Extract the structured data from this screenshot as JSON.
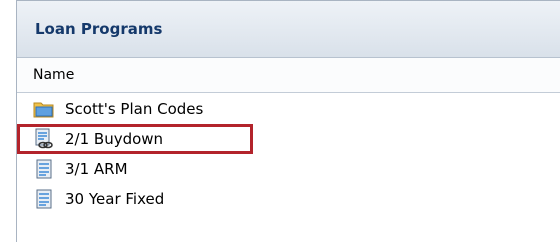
{
  "panel": {
    "title": "Loan Programs",
    "column_header": "Name"
  },
  "items": [
    {
      "label": "Scott's Plan Codes",
      "icon": "folder-icon"
    },
    {
      "label": "2/1 Buydown",
      "icon": "linked-document-icon",
      "highlighted": true
    },
    {
      "label": "3/1 ARM",
      "icon": "document-icon"
    },
    {
      "label": "30 Year Fixed",
      "icon": "document-icon"
    }
  ],
  "colors": {
    "title": "#15396b",
    "highlight_border": "#b3232b"
  }
}
